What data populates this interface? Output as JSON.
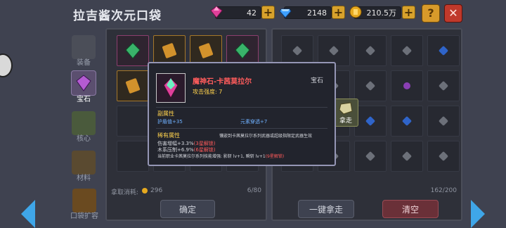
{
  "header": {
    "title": "拉吉酱次元口袋",
    "currency": [
      {
        "icon": "pink-gem-icon",
        "value": "42"
      },
      {
        "icon": "blue-diamond-icon",
        "value": "2148"
      },
      {
        "icon": "gold-coin-icon",
        "value": "210.5万"
      }
    ],
    "help_label": "?",
    "close_label": "✕"
  },
  "tabs": [
    {
      "label": "装备",
      "icon": "equipment-icon",
      "active": false
    },
    {
      "label": "宝石",
      "icon": "gem-tab-icon",
      "active": true
    },
    {
      "label": "核心",
      "icon": "core-icon",
      "active": false
    },
    {
      "label": "材料",
      "icon": "material-icon",
      "active": false
    },
    {
      "label": "口袋扩容",
      "icon": "pocket-expand-icon",
      "active": false
    }
  ],
  "left_panel": {
    "fee_label": "拿取消耗:",
    "fee_value": "296",
    "capacity": "6/80",
    "confirm_label": "确定"
  },
  "right_panel": {
    "capacity": "162/200",
    "take_all_label": "一键拿走",
    "clear_label": "清空"
  },
  "tooltip": {
    "name": "魔神石-卡茜莫拉尔",
    "category": "宝石",
    "attack": "攻击强度: 7",
    "sub_attr_title": "副属性",
    "sub_attr_1": "护盾值+35",
    "sub_attr_2": "元素穿透+7",
    "unique_title": "稀有属性",
    "unique_desc": "镶嵌到卡茜莫拉尔系列武器或超级指限定武器生效",
    "line_1": "伤害增幅+3.3%",
    "line_1_red": "(3星解锁)",
    "line_2": "木系压制+6.9%",
    "line_2_red": "(6星解锁)",
    "line_3": "当前职业卡茜莫拉尔系列技能增强: 影斩 lv+1, 瞬斩 lv+1",
    "line_3_red": "(9星解锁)"
  },
  "take_button_label": "拿走",
  "colors": {
    "accent_gold": "#d8a22c",
    "close_red": "#c0392b",
    "tooltip_border": "#9596b5",
    "item_name_red": "#ff5c5c"
  }
}
